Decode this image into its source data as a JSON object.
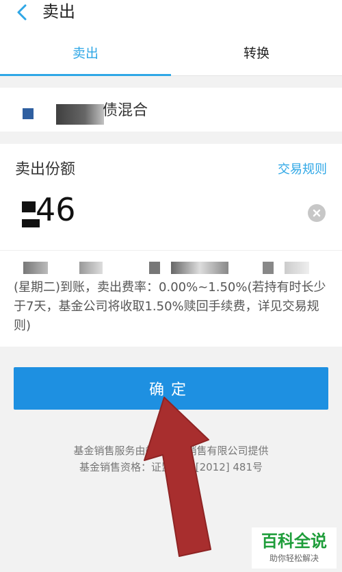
{
  "header": {
    "title": "卖出",
    "back_icon": "chevron-left-icon",
    "accent": "#2fa7e6"
  },
  "tabs": [
    {
      "label": "卖出",
      "active": true
    },
    {
      "label": "转换",
      "active": false
    }
  ],
  "fund": {
    "name_visible": "债混合"
  },
  "amount": {
    "label": "卖出份额",
    "rules_link": "交易规则",
    "value": "46",
    "clear_icon": "clear-circle-icon"
  },
  "note": {
    "text": "(星期二)到账，卖出费率：0.00%~1.50%(若持有时长少于7天，基金公司将收取1.50%赎回手续费，详见交易规则)"
  },
  "confirm": {
    "label": "确定",
    "color": "#1e90e1"
  },
  "footer": {
    "line1": "基金销售服务由蚂蚁基金销售有限公司提供",
    "line2": "基金销售资格：证监许可 [2012] 481号"
  },
  "watermark": {
    "title": "百科全说",
    "subtitle": "助你轻松解决"
  }
}
